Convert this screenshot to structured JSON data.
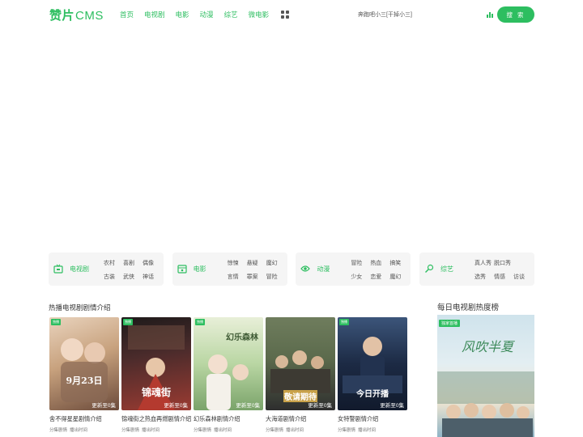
{
  "header": {
    "logo_text": "赞片",
    "logo_suffix": "CMS",
    "nav": [
      "首页",
      "电视剧",
      "电影",
      "动漫",
      "综艺",
      "微电影"
    ],
    "search_placeholder": "奔跑吧小三[干掉小三]",
    "search_button": "搜 索"
  },
  "categories": [
    {
      "name": "电视剧",
      "icon": "tv-icon",
      "links": [
        "农村",
        "喜剧",
        "偶像",
        "古装",
        "武侠",
        "神话"
      ]
    },
    {
      "name": "电影",
      "icon": "film-icon",
      "links": [
        "惊悚",
        "悬疑",
        "魔幻",
        "言情",
        "罪案",
        "冒险"
      ]
    },
    {
      "name": "动漫",
      "icon": "anime-icon",
      "links": [
        "冒险",
        "热血",
        "搞笑",
        "少女",
        "恋爱",
        "魔幻"
      ]
    },
    {
      "name": "综艺",
      "icon": "mic-icon",
      "links": [
        "真人秀",
        "脱口秀",
        "选秀",
        "情感",
        "访谈"
      ]
    }
  ],
  "section_left_title": "热播电视剧剧情介绍",
  "section_right_title": "每日电视剧热度榜",
  "cards": [
    {
      "title": "舍不得星星剧情介绍",
      "update": "更新至0集",
      "badge": "独播",
      "meta": [
        "分集剧情",
        "播出时间"
      ],
      "poster_text": "9月23日",
      "colors": [
        "#c8a27e",
        "#6b4a3a",
        "#e9d3bd"
      ]
    },
    {
      "title": "锦魂街之热血再燃剧情介绍",
      "update": "更新至0集",
      "badge": "独播",
      "meta": [
        "分集剧情",
        "播出时间"
      ],
      "poster_text": "锦魂街",
      "colors": [
        "#4a2b2b",
        "#9b3b32",
        "#1e1a1a"
      ]
    },
    {
      "title": "幻乐森林剧情介绍",
      "update": "更新至0集",
      "badge": "独播",
      "meta": [
        "分集剧情",
        "播出时间"
      ],
      "poster_text": "幻乐森林",
      "colors": [
        "#b9d6a3",
        "#7aa36a",
        "#e8efd8"
      ]
    },
    {
      "title": "大海道剧情介绍",
      "update": "更新至0集",
      "badge": "",
      "meta": [
        "分集剧情",
        "播出时间"
      ],
      "poster_text": "敬请期待",
      "colors": [
        "#5b6a4c",
        "#c9a24a",
        "#2e2e2e"
      ]
    },
    {
      "title": "女特警剧情介绍",
      "update": "更新至0集",
      "badge": "独播",
      "meta": [
        "分集剧情",
        "播出时间"
      ],
      "poster_text": "今日开播",
      "colors": [
        "#1c2a44",
        "#3c557a",
        "#111a2c"
      ]
    }
  ],
  "right_poster": {
    "badge": "独家首播",
    "poster_text": "风吹半夏",
    "colors": [
      "#cfe3ec",
      "#8fb4c6",
      "#f3e8d2"
    ]
  }
}
